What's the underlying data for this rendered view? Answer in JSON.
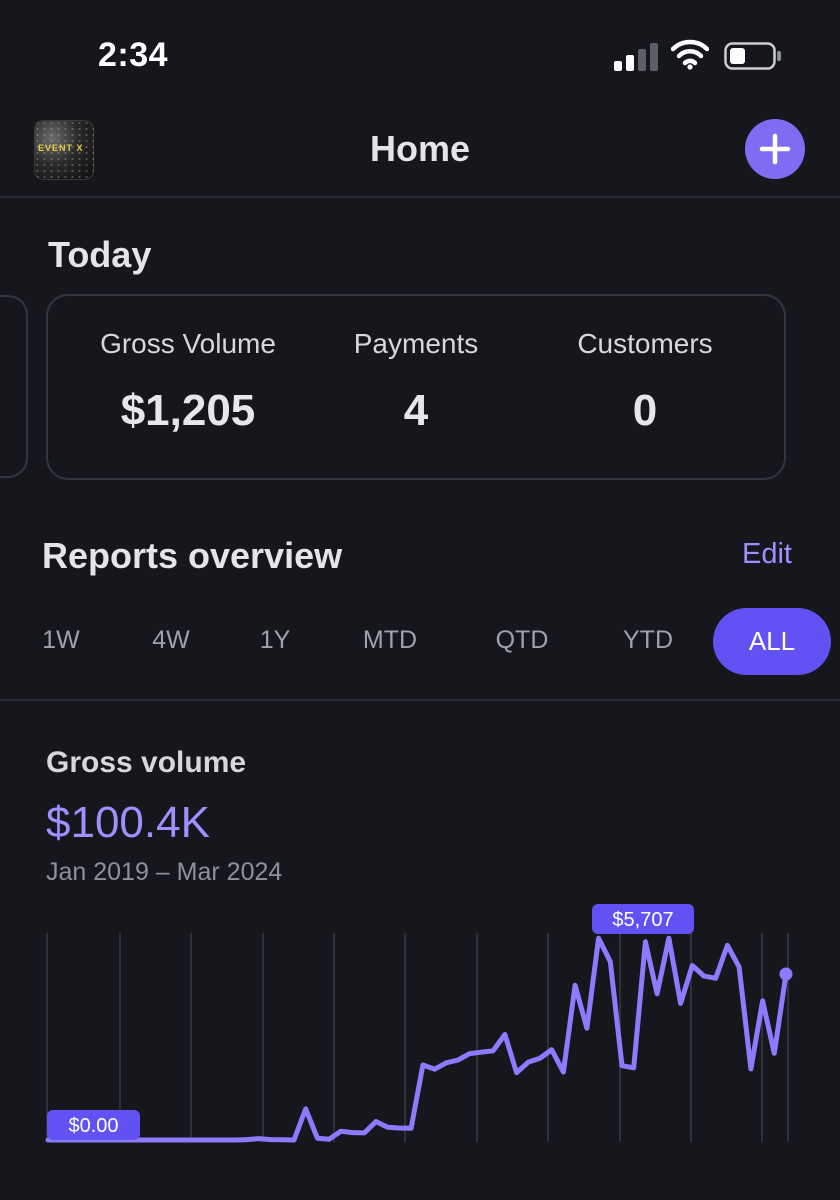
{
  "status_bar": {
    "time": "2:34"
  },
  "header": {
    "title": "Home",
    "avatar_text": "EVENT X"
  },
  "today": {
    "title": "Today",
    "metrics": [
      {
        "label": "Gross Volume",
        "value": "$1,205"
      },
      {
        "label": "Payments",
        "value": "4"
      },
      {
        "label": "Customers",
        "value": "0"
      }
    ]
  },
  "reports": {
    "title": "Reports overview",
    "edit_label": "Edit",
    "ranges": [
      "1W",
      "4W",
      "1Y",
      "MTD",
      "QTD",
      "YTD",
      "ALL"
    ],
    "active_range": "ALL"
  },
  "gross_chart": {
    "title": "Gross volume",
    "total": "$100.4K",
    "date_range": "Jan 2019 – Mar 2024"
  },
  "colors": {
    "accent": "#7d6df2",
    "accent_active": "#6352f3",
    "line": "#8b7bff",
    "background": "#15171d"
  },
  "chart_data": {
    "type": "line",
    "x_range": [
      "Jan 2019",
      "Mar 2024"
    ],
    "y_range": [
      0,
      5707
    ],
    "grid": "vertical",
    "labels": {
      "min": "$0.00",
      "max": "$5,707"
    },
    "series": [
      {
        "values": [
          0,
          0,
          0,
          0,
          0,
          0,
          0,
          0,
          0,
          0,
          0,
          0,
          0,
          0,
          0,
          0,
          0,
          10,
          40,
          10,
          5,
          0,
          880,
          50,
          20,
          250,
          210,
          200,
          520,
          360,
          340,
          330,
          2120,
          2000,
          2180,
          2260,
          2440,
          2480,
          2520,
          2980,
          1900,
          2200,
          2310,
          2550,
          1920,
          4370,
          3160,
          5700,
          5040,
          2100,
          2040,
          5600,
          4130,
          5700,
          3860,
          4930,
          4630,
          4570,
          5500,
          4890,
          2010,
          3930,
          2450,
          4690
        ]
      }
    ]
  }
}
